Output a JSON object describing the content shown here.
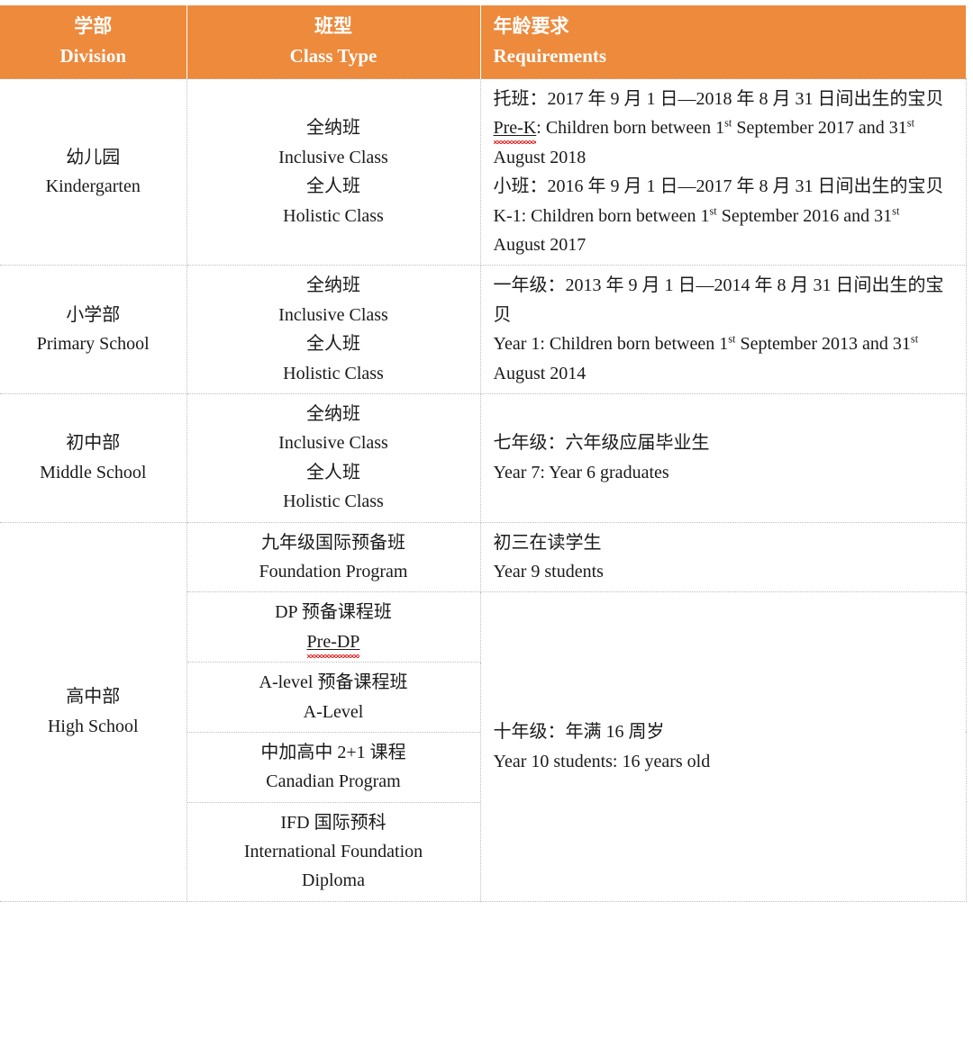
{
  "table": {
    "accent_color": "#ED8A3C",
    "header_text_color": "#FFFFFF",
    "border_color": "#BDBDBD",
    "columns": [
      {
        "cn": "学部",
        "en": "Division"
      },
      {
        "cn": "班型",
        "en": "Class Type"
      },
      {
        "cn": "年龄要求",
        "en": "Requirements"
      }
    ],
    "rows": [
      {
        "division": {
          "cn": "幼儿园",
          "en": "Kindergarten"
        },
        "class_type": {
          "l1": "全纳班",
          "l2": "Inclusive Class",
          "l3": "全人班",
          "l4": "Holistic Class"
        },
        "requirements": {
          "p1_cn": "托班：2017 年 9 月 1 日—2018 年 8 月 31 日间出生的宝贝",
          "p1_en_label": "Pre-K",
          "p1_en_a": ": Children born between 1",
          "p1_en_sup1": "st",
          "p1_en_b": " September 2017 and 31",
          "p1_en_sup2": "st",
          "p1_en_c": " August 2018",
          "p2_cn": "小班：2016 年 9 月 1 日—2017 年 8 月 31 日间出生的宝贝",
          "p2_en_label": "K-1",
          "p2_en_a": ": Children born between 1",
          "p2_en_sup1": "st",
          "p2_en_b": " September 2016 and 31",
          "p2_en_sup2": "st",
          "p2_en_c": " August 2017"
        }
      },
      {
        "division": {
          "cn": "小学部",
          "en": "Primary School"
        },
        "class_type": {
          "l1": "全纳班",
          "l2": "Inclusive Class",
          "l3": "全人班",
          "l4": "Holistic Class"
        },
        "requirements": {
          "p1_cn": "一年级：2013 年 9 月 1 日—2014 年 8 月 31 日间出生的宝贝",
          "p1_en_label": "Year 1",
          "p1_en_a": ": Children born between 1",
          "p1_en_sup1": "st",
          "p1_en_b": " September 2013 and 31",
          "p1_en_sup2": "st",
          "p1_en_c": " August 2014"
        }
      },
      {
        "division": {
          "cn": "初中部",
          "en": "Middle School"
        },
        "class_type": {
          "l1": "全纳班",
          "l2": "Inclusive Class",
          "l3": "全人班",
          "l4": "Holistic Class"
        },
        "requirements": {
          "p1_cn": "七年级：六年级应届毕业生",
          "p1_en": "Year 7: Year 6 graduates"
        }
      }
    ],
    "high_school": {
      "division": {
        "cn": "高中部",
        "en": "High School"
      },
      "programs": [
        {
          "cn": "九年级国际预备班",
          "en": "Foundation Program",
          "en_spell": false
        },
        {
          "cn": "DP 预备课程班",
          "en": "Pre-DP",
          "en_spell": true
        },
        {
          "cn": "A-level 预备课程班",
          "en": "A-Level",
          "en_spell": false
        },
        {
          "cn": "中加高中 2+1 课程",
          "en": "Canadian Program",
          "en_spell": false
        },
        {
          "cn": "IFD 国际预科",
          "en": "International Foundation",
          "en2": "Diploma",
          "en_spell": false
        }
      ],
      "requirement_foundation": {
        "cn": "初三在读学生",
        "en": "Year 9 students"
      },
      "requirement_rest": {
        "cn": "十年级：年满 16 周岁",
        "en": "Year 10 students: 16 years old"
      }
    }
  }
}
